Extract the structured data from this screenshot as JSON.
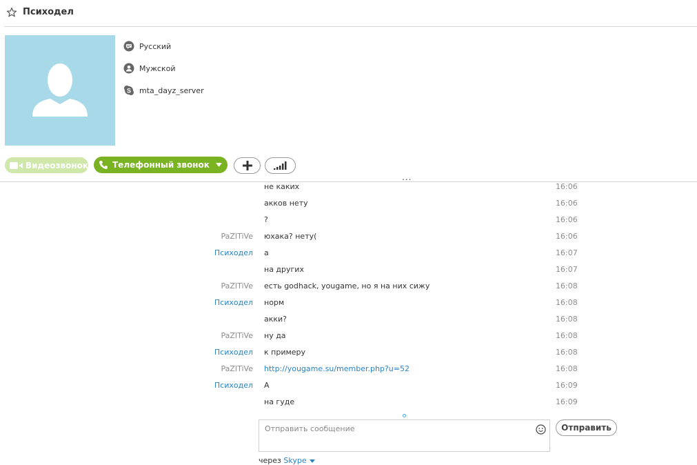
{
  "header": {
    "title": "Психодел"
  },
  "profile": {
    "language": "Русский",
    "gender": "Мужской",
    "skype_name": "mta_dayz_server"
  },
  "actions": {
    "video_call": "Видеозвонок",
    "phone_call": "Телефонный звонок",
    "more": "..."
  },
  "messages": [
    {
      "sender": "",
      "text": "не каких",
      "time": "16:06"
    },
    {
      "sender": "",
      "text": "акков нету",
      "time": "16:06"
    },
    {
      "sender": "",
      "text": "?",
      "time": "16:06"
    },
    {
      "sender": "PaZITiVe",
      "text": "юхака? нету(",
      "time": "16:06"
    },
    {
      "sender": "Психодел",
      "text": "а",
      "time": "16:07"
    },
    {
      "sender": "",
      "text": "на других",
      "time": "16:07"
    },
    {
      "sender": "PaZITiVe",
      "text": "есть godhack, yougame, но я на них сижу",
      "time": "16:08"
    },
    {
      "sender": "Психодел",
      "text": "норм",
      "time": "16:08"
    },
    {
      "sender": "",
      "text": "акки?",
      "time": "16:08"
    },
    {
      "sender": "PaZITiVe",
      "text": "ну да",
      "time": "16:08"
    },
    {
      "sender": "Психодел",
      "text": "к примеру",
      "time": "16:08"
    },
    {
      "sender": "PaZITiVe",
      "text": "http://yougame.su/member.php?u=52",
      "time": "16:08"
    },
    {
      "sender": "Психодел",
      "text": "А",
      "time": "16:09"
    },
    {
      "sender": "",
      "text": "на гуде",
      "time": "16:09"
    }
  ],
  "compose": {
    "placeholder": "Отправить сообщение",
    "send_label": "Отправить",
    "via_prefix": "через",
    "via_service": "Skype"
  },
  "colors": {
    "accent_green": "#79b321",
    "accent_green_disabled": "#cfe7a9",
    "link_blue": "#2a83c5",
    "avatar_bg": "#a8d9e9"
  }
}
